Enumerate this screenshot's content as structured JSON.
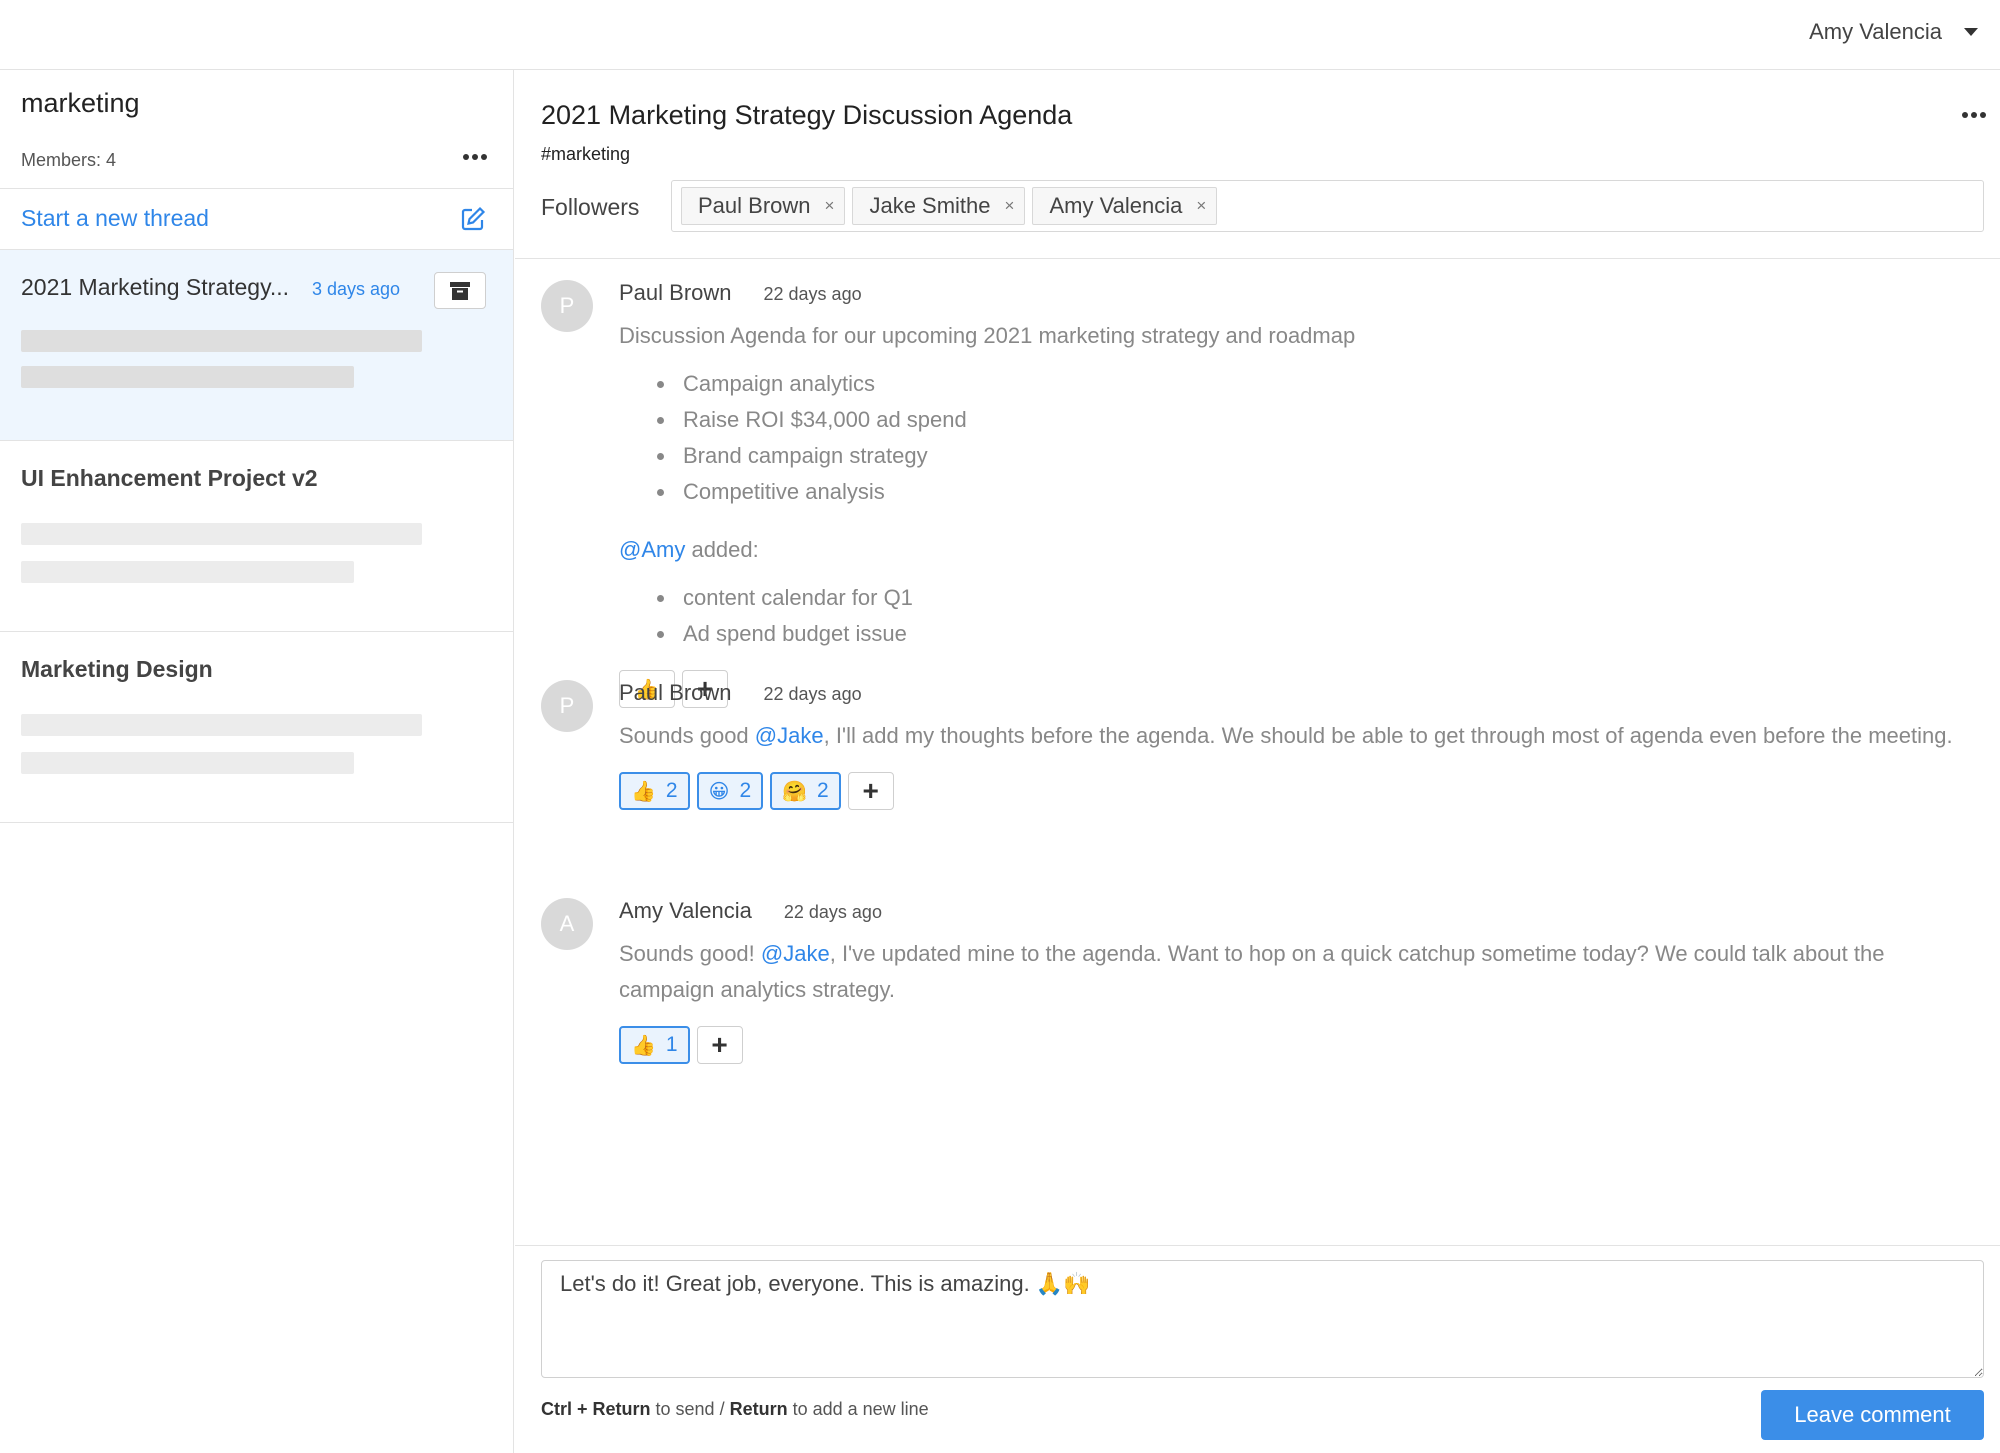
{
  "header": {
    "user_name": "Amy Valencia"
  },
  "sidebar": {
    "channel_name": "marketing",
    "members_label": "Members: 4",
    "new_thread_label": "Start a new thread",
    "threads": [
      {
        "title": "2021 Marketing Strategy...",
        "time": "3 days ago",
        "active": true
      },
      {
        "title": "UI Enhancement Project v2",
        "time": "",
        "active": false
      },
      {
        "title": "Marketing Design",
        "time": "",
        "active": false
      }
    ]
  },
  "main": {
    "title": "2021 Marketing Strategy Discussion Agenda",
    "tag": "#marketing",
    "followers_label": "Followers",
    "followers": [
      "Paul Brown",
      "Jake Smithe",
      "Amy Valencia"
    ],
    "remove_glyph": "×",
    "comments": [
      {
        "avatar": "P",
        "author": "Paul Brown",
        "time": "22 days ago",
        "intro": "Discussion Agenda for our upcoming 2021 marketing strategy and roadmap",
        "list1": [
          "Campaign analytics",
          "Raise ROI $34,000 ad spend",
          "Brand campaign strategy",
          "Competitive analysis"
        ],
        "mention": "@Amy",
        "mention_rest": " added:",
        "list2": [
          "content calendar for Q1",
          "Ad spend budget issue"
        ],
        "reactions": [
          {
            "emoji": "👍",
            "count": ""
          }
        ]
      },
      {
        "avatar": "P",
        "author": "Paul Brown",
        "time": "22 days ago",
        "text_before": "Sounds good ",
        "mention": "@Jake",
        "text_after": ", I'll add my thoughts before the agenda. We should be able to get through most of agenda even before the meeting.",
        "reactions": [
          {
            "emoji": "👍",
            "count": "2"
          },
          {
            "emoji": "😀",
            "count": "2"
          },
          {
            "emoji": "🤗",
            "count": "2"
          }
        ]
      },
      {
        "avatar": "A",
        "author": "Amy Valencia",
        "time": "22 days ago",
        "text_before": "Sounds good! ",
        "mention": "@Jake",
        "text_after": ", I've updated mine to the agenda. Want to hop on a quick catchup sometime today? We could talk about the campaign analytics strategy.",
        "reactions": [
          {
            "emoji": "👍",
            "count": "1"
          }
        ]
      }
    ],
    "add_reaction_glyph": "+"
  },
  "composer": {
    "value": "Let's do it! Great job, everyone. This is amazing. 🙏🙌",
    "hint_key1": "Ctrl + Return",
    "hint_mid": " to send / ",
    "hint_key2": "Return",
    "hint_end": " to add a new line",
    "send_label": "Leave comment"
  },
  "colors": {
    "accent": "#2f86e8",
    "button": "#3b8ee8",
    "active_thread_bg": "#eef6fe"
  },
  "icons": [
    "chevron-down-icon",
    "more-icon",
    "edit-icon",
    "archive-icon",
    "close-icon",
    "plus-icon"
  ]
}
